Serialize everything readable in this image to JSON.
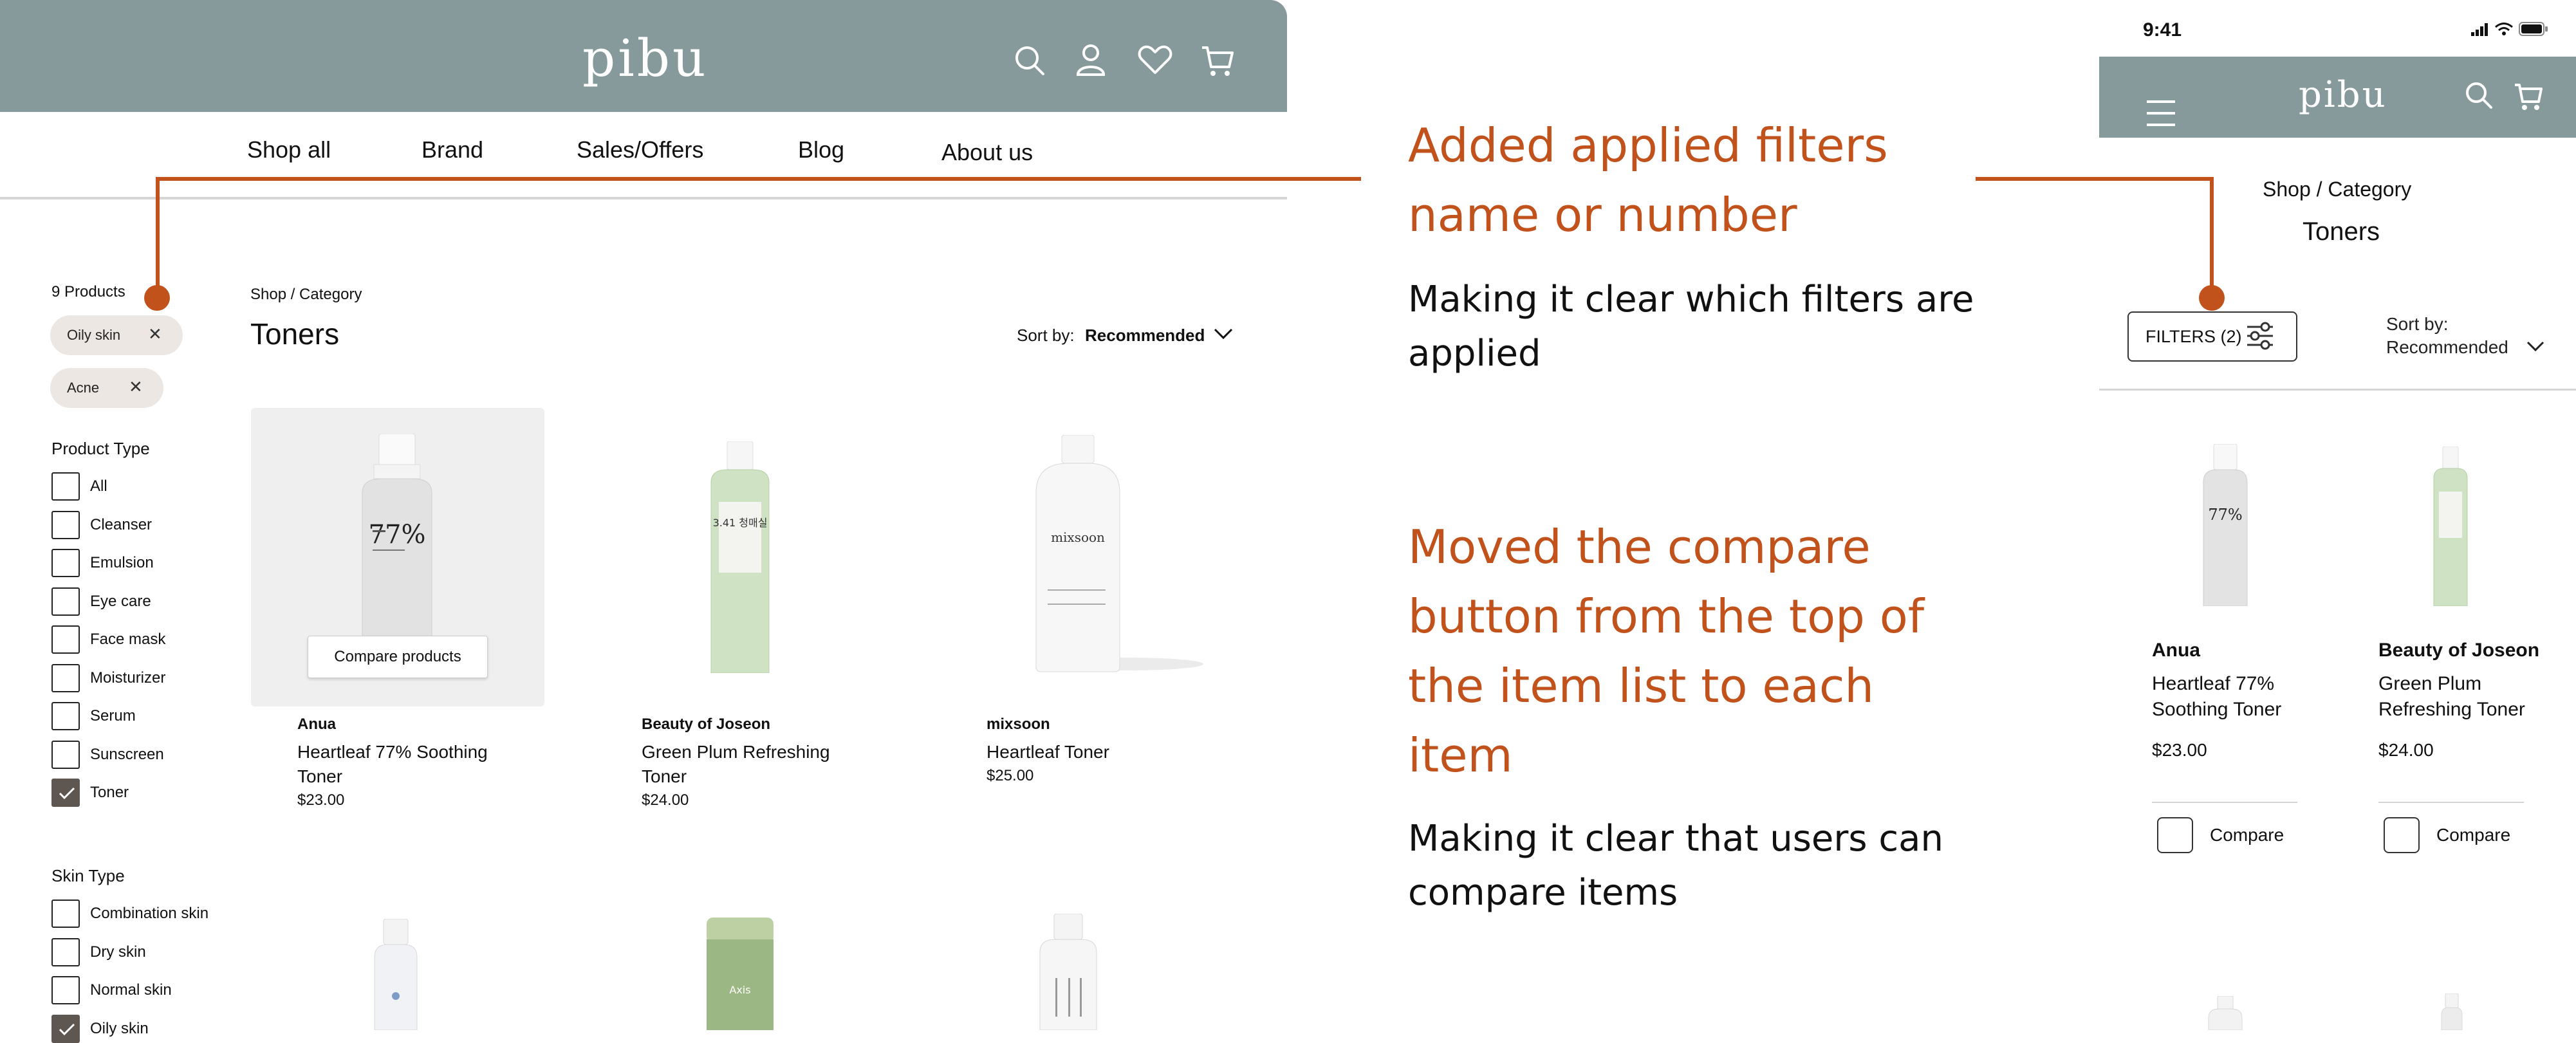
{
  "desktop": {
    "brand": "pibu",
    "nav": [
      "Shop all",
      "Brand",
      "Sales/Offers",
      "Blog",
      "About us"
    ],
    "product_count": "9 Products",
    "applied_filters": [
      "Oily skin",
      "Acne"
    ],
    "product_type_heading": "Product Type",
    "product_types": [
      {
        "label": "All",
        "checked": false
      },
      {
        "label": "Cleanser",
        "checked": false
      },
      {
        "label": "Emulsion",
        "checked": false
      },
      {
        "label": "Eye care",
        "checked": false
      },
      {
        "label": "Face mask",
        "checked": false
      },
      {
        "label": "Moisturizer",
        "checked": false
      },
      {
        "label": "Serum",
        "checked": false
      },
      {
        "label": "Sunscreen",
        "checked": false
      },
      {
        "label": "Toner",
        "checked": true
      }
    ],
    "skin_type_heading": "Skin Type",
    "skin_types": [
      {
        "label": "Combination skin",
        "checked": false
      },
      {
        "label": "Dry skin",
        "checked": false
      },
      {
        "label": "Normal skin",
        "checked": false
      },
      {
        "label": "Oily skin",
        "checked": true
      }
    ],
    "breadcrumb": "Shop / Category",
    "page_title": "Toners",
    "sort_label": "Sort by:",
    "sort_value": "Recommended",
    "compare_button": "Compare products",
    "products": [
      {
        "brand": "Anua",
        "name": "Heartleaf 77% Soothing Toner",
        "price": "$23.00"
      },
      {
        "brand": "Beauty of Joseon",
        "name": "Green Plum Refreshing Toner",
        "price": "$24.00"
      },
      {
        "brand": "mixsoon",
        "name": "Heartleaf Toner",
        "price": "$25.00"
      }
    ],
    "bottle_text": {
      "anua": "77%",
      "joseon": "3.41 청매실",
      "mixsoon": "mixsoon",
      "axis": "Axis"
    }
  },
  "annotations": {
    "a1_title": [
      "Added applied filters",
      "name or number"
    ],
    "a1_body": [
      "Making it clear which filters are",
      "applied"
    ],
    "a2_title": [
      "Moved the compare",
      "button from the top of",
      "the item list to each",
      "item"
    ],
    "a2_body": [
      "Making it clear that users can",
      "compare items"
    ]
  },
  "mobile": {
    "time": "9:41",
    "brand": "pibu",
    "breadcrumb": "Shop / Category",
    "page_title": "Toners",
    "filters_button": "FILTERS (2)",
    "sort_label": "Sort by:",
    "sort_value": "Recommended",
    "compare_label": "Compare",
    "products": [
      {
        "brand": "Anua",
        "name_line1": "Heartleaf 77%",
        "name_line2": "Soothing Toner",
        "price": "$23.00"
      },
      {
        "brand": "Beauty of Joseon",
        "name_line1": "Green Plum",
        "name_line2": "Refreshing Toner",
        "price": "$24.00"
      }
    ]
  },
  "colors": {
    "header": "#86999b",
    "accent": "#c2521b",
    "check": "#5e5650",
    "chip": "#ede7e3"
  }
}
